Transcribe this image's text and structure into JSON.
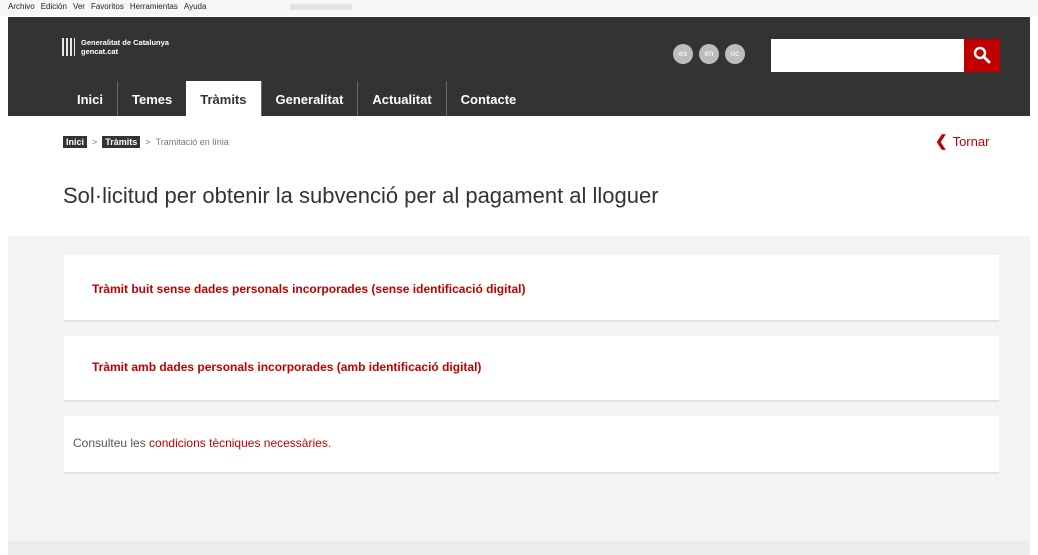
{
  "browser": {
    "menu": [
      "Archivo",
      "Edición",
      "Ver",
      "Favoritos",
      "Herramientas",
      "Ayuda"
    ]
  },
  "header": {
    "logo_line1": "Generalitat de Catalunya",
    "logo_line2": "gencat.cat",
    "languages": [
      "es",
      "en",
      "oc"
    ],
    "search_placeholder": "",
    "search_icon": "search-icon"
  },
  "nav": {
    "items": [
      {
        "label": "Inici",
        "active": false
      },
      {
        "label": "Temes",
        "active": false
      },
      {
        "label": "Tràmits",
        "active": true
      },
      {
        "label": "Generalitat",
        "active": false
      },
      {
        "label": "Actualitat",
        "active": false
      },
      {
        "label": "Contacte",
        "active": false
      }
    ]
  },
  "breadcrumb": {
    "items": [
      "Inici",
      "Tràmits",
      "Tramitació en línia"
    ],
    "separator": ">"
  },
  "back": {
    "icon": "chevron-left-icon",
    "label": "Tornar"
  },
  "page": {
    "title": "Sol·licitud per obtenir la subvenció per al pagament al lloguer"
  },
  "cards": {
    "option1": "Tràmit buit sense dades personals incorporades (sense identificació digital)",
    "option2": "Tràmit amb dades personals incorporades (amb identificació digital)",
    "info_prefix": "Consulteu les ",
    "info_link": "condicions tècniques necessàries",
    "info_suffix": "."
  },
  "colors": {
    "header_bg": "#333333",
    "accent": "#c00000",
    "content_bg": "#f3f3f3"
  }
}
